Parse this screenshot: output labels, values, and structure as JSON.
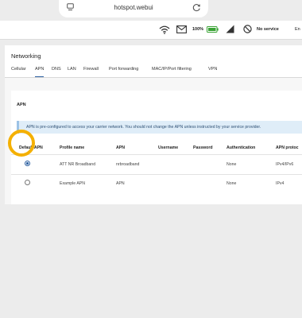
{
  "browser": {
    "url": "hotspot.webui"
  },
  "status_bar": {
    "battery_percent": "100%",
    "service_text": "No service",
    "language_text": "En"
  },
  "page": {
    "title": "Networking"
  },
  "tabs": [
    {
      "label": "Cellular",
      "active": false
    },
    {
      "label": "APN",
      "active": true
    },
    {
      "label": "DNS",
      "active": false
    },
    {
      "label": "LAN",
      "active": false
    },
    {
      "label": "Firewall",
      "active": false
    },
    {
      "label": "Port forwarding",
      "active": false
    },
    {
      "label": "MAC/IP/Port filtering",
      "active": false
    },
    {
      "label": "VPN",
      "active": false
    }
  ],
  "apn_section": {
    "heading": "APN",
    "info_text": "APN is pre-configured to access your carrier network. You should not change the APN unless instructed by your service provider.",
    "columns": [
      "Default APN",
      "Profile name",
      "APN",
      "Username",
      "Password",
      "Authentication",
      "APN protoc"
    ],
    "rows": [
      {
        "default": true,
        "profile_name": "ATT NR Broadband",
        "apn": "nrbroadband",
        "username": "",
        "password": "",
        "authentication": "None",
        "protocol": "IPv4/IPv6"
      },
      {
        "default": false,
        "profile_name": "Example APN",
        "apn": "APN",
        "username": "",
        "password": "",
        "authentication": "None",
        "protocol": "IPv4"
      }
    ]
  },
  "colors": {
    "accent": "#2b5fa0",
    "highlight_ring": "#f4b000",
    "info_banner": "#dfedf8",
    "battery": "#3aa335"
  }
}
